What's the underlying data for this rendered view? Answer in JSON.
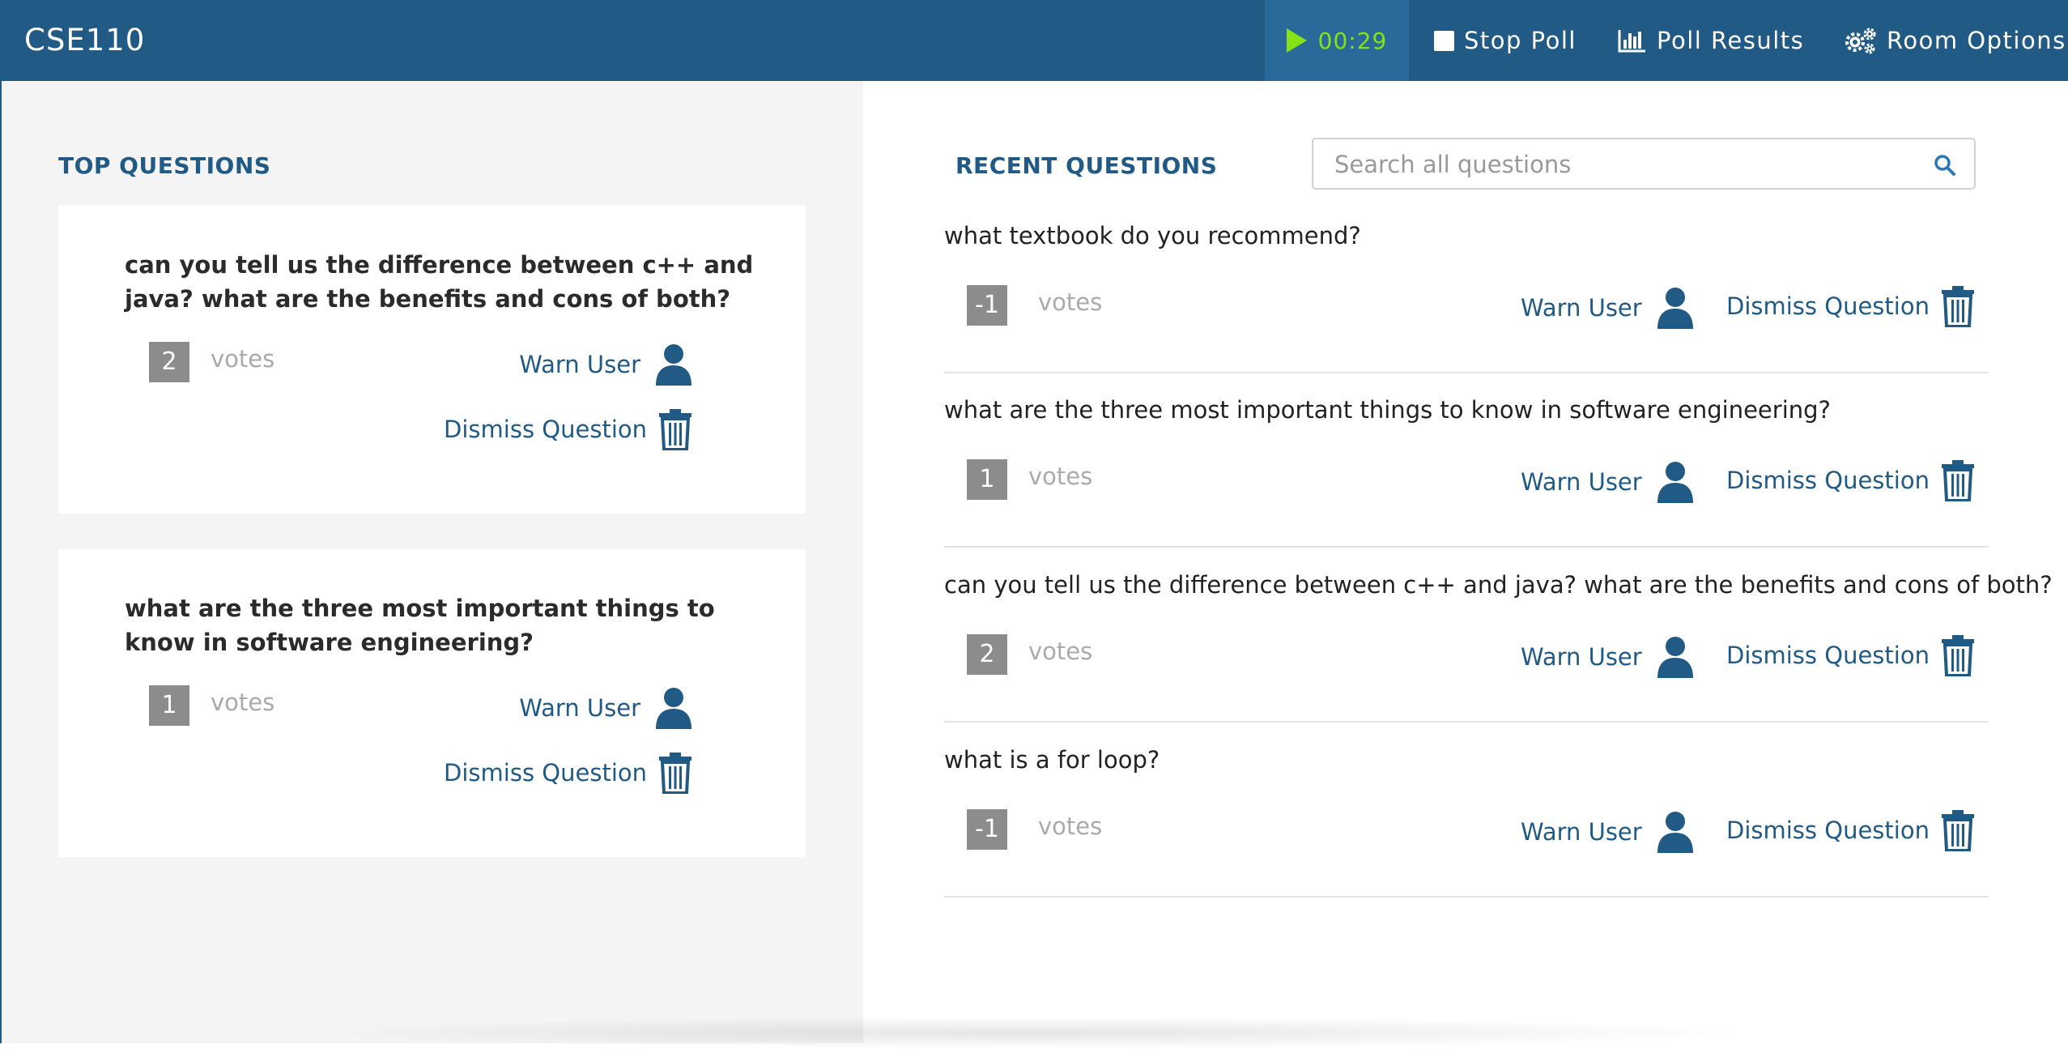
{
  "header": {
    "brand": "CSE110",
    "timer": "00:29",
    "stop_poll": "Stop Poll",
    "poll_results": "Poll Results",
    "room_options": "Room Options"
  },
  "top_questions": {
    "title": "TOP QUESTIONS",
    "items": [
      {
        "question": "can you tell us the difference between c++ and java? what are the benefits and cons of both?",
        "votes": "2",
        "votes_label": "votes",
        "warn": "Warn User",
        "dismiss": "Dismiss Question"
      },
      {
        "question": "what are the three most important things to know in software engineering?",
        "votes": "1",
        "votes_label": "votes",
        "warn": "Warn User",
        "dismiss": "Dismiss Question"
      }
    ]
  },
  "recent_questions": {
    "title": "RECENT QUESTIONS",
    "search_placeholder": "Search all questions",
    "items": [
      {
        "question": "what textbook do you recommend?",
        "votes": "-1",
        "votes_label": "votes",
        "warn": "Warn User",
        "dismiss": "Dismiss Question"
      },
      {
        "question": "what are the three most important things to know in software engineering?",
        "votes": "1",
        "votes_label": "votes",
        "warn": "Warn User",
        "dismiss": "Dismiss Question"
      },
      {
        "question": "can you tell us the difference between c++ and java? what are the benefits and cons of both?",
        "votes": "2",
        "votes_label": "votes",
        "warn": "Warn User",
        "dismiss": "Dismiss Question"
      },
      {
        "question": "what is a for loop?",
        "votes": "-1",
        "votes_label": "votes",
        "warn": "Warn User",
        "dismiss": "Dismiss Question"
      }
    ]
  },
  "icons": {
    "play": "play-icon",
    "stop": "stop-icon",
    "bar_chart": "bar-chart-icon",
    "gears": "gears-icon",
    "search": "search-icon",
    "user": "user-icon",
    "trash": "trash-icon"
  },
  "colors": {
    "primary": "#215a85",
    "timer_green": "#84e316",
    "vote_badge": "#8c8c8c",
    "left_panel_bg": "#f4f4f4"
  }
}
